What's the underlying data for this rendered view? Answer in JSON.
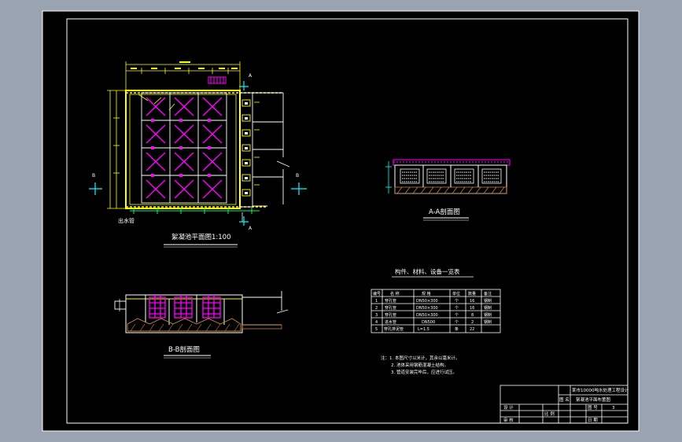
{
  "colors": {
    "background": "#9aa3b2",
    "sheet": "#000000",
    "frame": "#ffffff",
    "wall": "#ffff00",
    "pipe": "#ff00ff",
    "dimension": "#00ffff",
    "section_mark": "#00ff66",
    "hatch": "#cc8844"
  },
  "plan_view": {
    "title": "絮凝池平面图1:100",
    "label_outlet": "出水管"
  },
  "section_aa": {
    "title": "A-A剖面图"
  },
  "section_bb": {
    "title": "B-B剖面图"
  },
  "section_marks": {
    "a": "A",
    "b": "B"
  },
  "materials_table": {
    "title": "构件、材料、设备一览表",
    "headers": [
      "编号",
      "名 称",
      "规   格",
      "单位",
      "数量",
      "备注"
    ],
    "rows": [
      [
        "1",
        "穿孔管",
        "DN50×300",
        "个",
        "16",
        "钢制"
      ],
      [
        "2",
        "穿孔管",
        "DN50×300",
        "个",
        "16",
        "钢制"
      ],
      [
        "3",
        "穿孔管",
        "DN50×300",
        "个",
        "8",
        "钢制"
      ],
      [
        "4",
        "进水管",
        "DN500",
        "个",
        "2",
        "钢制"
      ],
      [
        "5",
        "穿孔排泥管",
        "L=1.5",
        "条",
        "22",
        ""
      ]
    ]
  },
  "notes": [
    "注：1. 本图尺寸以米计，其余以毫米计。",
    "2. 池体采用钢筋混凝土结构。",
    "3. 管道安装完毕后，应进行试压。"
  ],
  "title_block": {
    "project": "某市10000吨水处理工程设计",
    "drawing": "絮凝池平面布置图",
    "cell_a": "设 计",
    "cell_b": "审 核",
    "cell_c": "比 例",
    "cell_d": "图 号",
    "cell_e": "日 期",
    "cell_f": "图 名",
    "sheet_no": "3"
  }
}
